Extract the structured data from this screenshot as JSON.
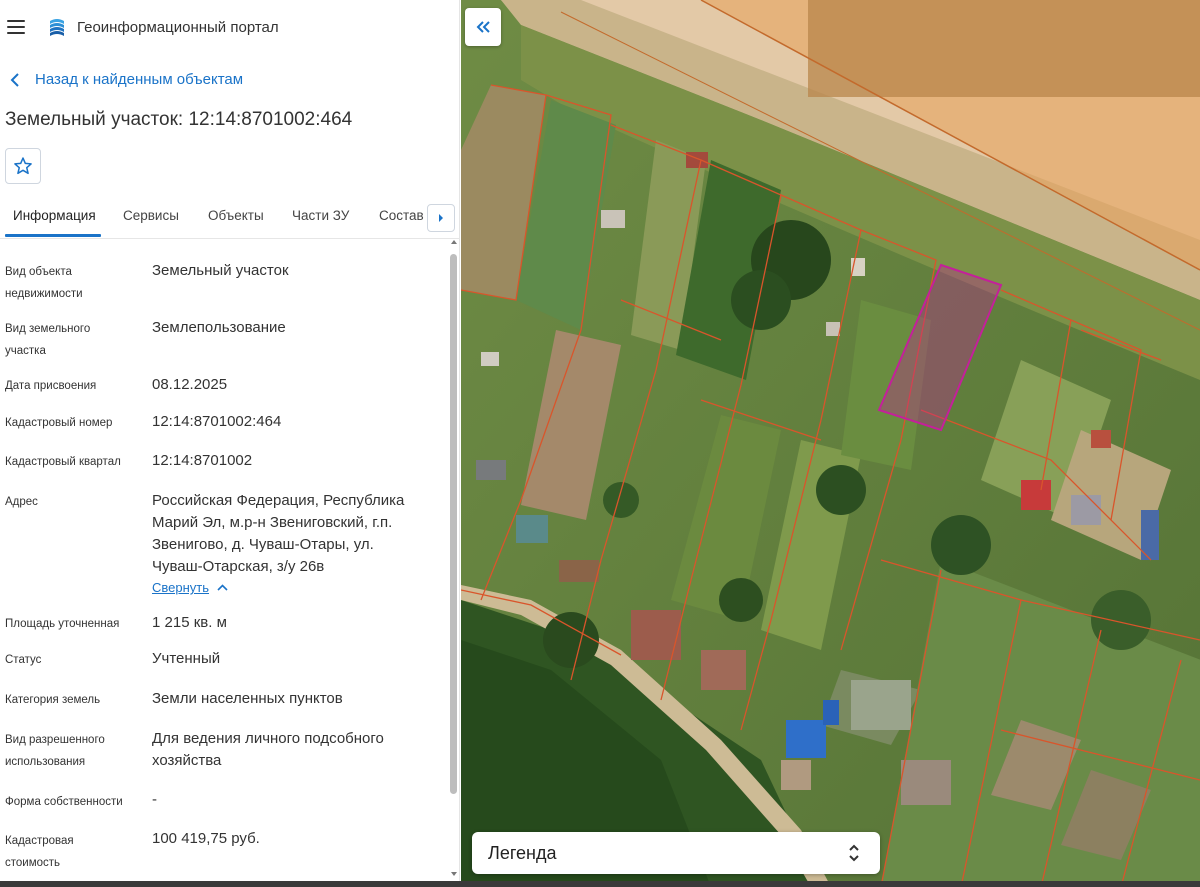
{
  "header": {
    "title": "Геоинформационный портал"
  },
  "navigation": {
    "back_label": "Назад к найденным объектам"
  },
  "object": {
    "title": "Земельный участок: 12:14:8701002:464"
  },
  "tabs": [
    {
      "label": "Информация",
      "active": true
    },
    {
      "label": "Сервисы",
      "active": false
    },
    {
      "label": "Объекты",
      "active": false
    },
    {
      "label": "Части ЗУ",
      "active": false
    },
    {
      "label": "Состав",
      "active": false
    }
  ],
  "info": [
    {
      "label_lines": [
        "Вид объекта",
        "недвижимости"
      ],
      "value": "Земельный участок"
    },
    {
      "label_lines": [
        "Вид земельного",
        "участка"
      ],
      "value": "Землепользование"
    },
    {
      "label_lines": [
        "Дата присвоения"
      ],
      "value": "08.12.2025"
    },
    {
      "label_lines": [
        "Кадастровый номер"
      ],
      "value": "12:14:8701002:464"
    },
    {
      "label_lines": [
        "Кадастровый квартал"
      ],
      "value": "12:14:8701002"
    },
    {
      "label_lines": [
        "Адрес"
      ],
      "value_lines": [
        "Российская Федерация, Республика",
        "Марий Эл, м.р-н Звениговский, г.п.",
        "Звенигово, д. Чуваш-Отары, ул.",
        "Чуваш-Отарская, з/у 26в"
      ]
    },
    {
      "label_lines": [
        "Площадь уточненная"
      ],
      "value": "1 215 кв. м"
    },
    {
      "label_lines": [
        "Статус"
      ],
      "value": "Учтенный"
    },
    {
      "label_lines": [
        "Категория земель"
      ],
      "value": "Земли населенных пунктов"
    },
    {
      "label_lines": [
        "Вид разрешенного",
        "использования"
      ],
      "value_lines": [
        "Для ведения личного подсобного",
        "хозяйства"
      ]
    },
    {
      "label_lines": [
        "Форма собственности"
      ],
      "value": "-"
    },
    {
      "label_lines": [
        "Кадастровая",
        "стоимость"
      ],
      "value": "100 419,75 руб."
    }
  ],
  "collapse_label": "Свернуть",
  "legend": {
    "label": "Легенда"
  },
  "icons": {
    "menu": "menu-icon",
    "logo": "logo-icon",
    "back": "chevron-left-icon",
    "favorite": "star-icon",
    "tabs_next": "chevron-right-icon",
    "collapse_panel": "double-chevron-left-icon",
    "legend_toggle": "unfold-icon"
  },
  "colors": {
    "accent": "#1a73c8",
    "selected_parcel": "#c4209a",
    "parcel_border": "#d9552b",
    "zone_fill": "#e8a05a"
  }
}
